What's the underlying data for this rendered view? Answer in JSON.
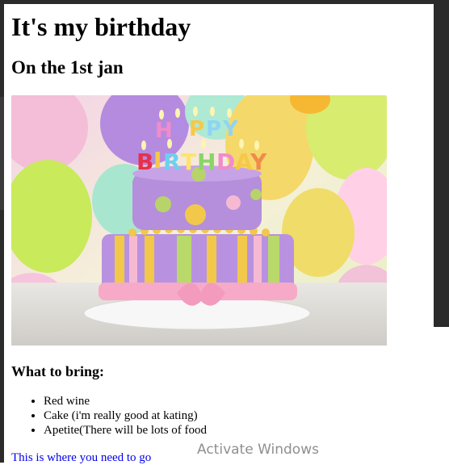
{
  "heading": "It's my birthday",
  "subheading": "On the 1st jan",
  "image": {
    "description_icon": "birthday-cake-image",
    "candle_text": "HAPPY BIRTHDAY"
  },
  "bring_heading": "What to bring:",
  "bring_items": [
    "Red wine",
    "Cake (i'm really good at kating)",
    "Apetite(There will be lots of food"
  ],
  "link_text": "This is where you need to go",
  "watermark": "Activate Windows"
}
